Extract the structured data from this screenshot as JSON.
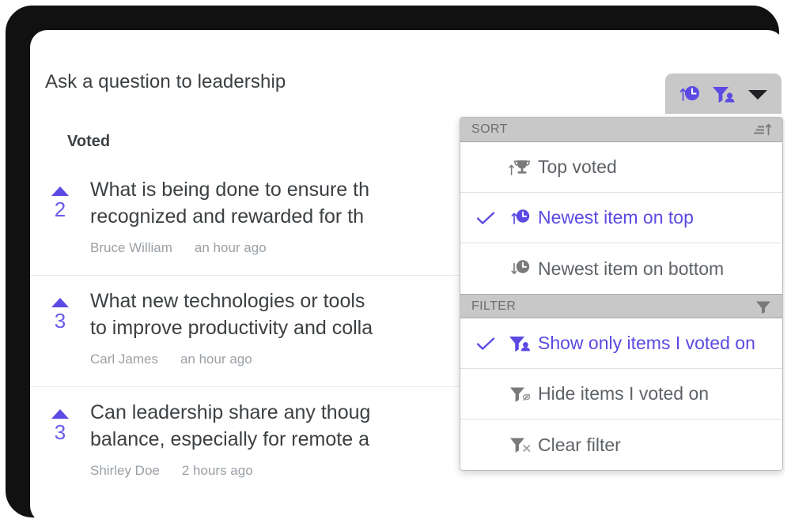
{
  "header": {
    "title": "Ask a question to leadership"
  },
  "toolbar": {
    "buttons": [
      {
        "name": "sort-newest-on-top-icon",
        "label": "Newest item on top",
        "color": "#5b4ae3"
      },
      {
        "name": "filter-voted-icon",
        "label": "Show only items I voted on",
        "color": "#5b4ae3"
      },
      {
        "name": "chevron-down-icon",
        "label": "Open sort and filter menu",
        "color": "#202124"
      }
    ]
  },
  "list": {
    "section_label": "Voted",
    "items": [
      {
        "votes": "2",
        "text_line1": "What is being done to ensure th",
        "text_line2": "recognized and rewarded for th",
        "author": "Bruce William",
        "time": "an hour ago"
      },
      {
        "votes": "3",
        "text_line1": "What new technologies or tools",
        "text_line2": "to improve productivity and colla",
        "author": "Carl James",
        "time": "an hour ago"
      },
      {
        "votes": "3",
        "text_line1": "Can leadership share any thoug",
        "text_line2": "balance, especially for remote a",
        "author": "Shirley Doe",
        "time": "2 hours ago"
      }
    ]
  },
  "menu": {
    "sort": {
      "header": "SORT",
      "header_icon": "sort-ascending-icon",
      "options": [
        {
          "label": "Top voted",
          "icon": "trophy-up-icon",
          "selected": false
        },
        {
          "label": "Newest item on top",
          "icon": "clock-up-icon",
          "selected": true
        },
        {
          "label": "Newest item on bottom",
          "icon": "clock-down-icon",
          "selected": false
        }
      ]
    },
    "filter": {
      "header": "FILTER",
      "header_icon": "funnel-icon",
      "options": [
        {
          "label": "Show only items I voted on",
          "icon": "funnel-person-icon",
          "selected": true
        },
        {
          "label": "Hide items I voted on",
          "icon": "funnel-hide-icon",
          "selected": false
        },
        {
          "label": "Clear filter",
          "icon": "funnel-clear-icon",
          "selected": false
        }
      ]
    }
  },
  "colors": {
    "accent": "#5b4ae3",
    "text": "#3c4043",
    "muted": "#9aa0a6",
    "header_bar": "#c8c8c8"
  }
}
